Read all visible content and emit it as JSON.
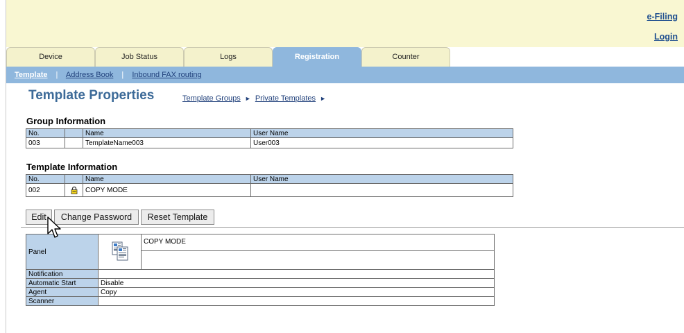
{
  "header": {
    "efiling_link": "e-Filing",
    "login_link": "Login"
  },
  "tabs": [
    {
      "label": "Device",
      "active": false
    },
    {
      "label": "Job Status",
      "active": false
    },
    {
      "label": "Logs",
      "active": false
    },
    {
      "label": "Registration",
      "active": true
    },
    {
      "label": "Counter",
      "active": false
    }
  ],
  "subnav": {
    "current": "Template",
    "separator": "|",
    "address_book": "Address Book",
    "inbound_fax": "Inbound FAX routing"
  },
  "page": {
    "title": "Template Properties",
    "breadcrumb": [
      "Template Groups",
      "Private Templates"
    ],
    "breadcrumb_arrow": "►"
  },
  "group_info": {
    "title": "Group Information",
    "headers": {
      "no": "No.",
      "name": "Name",
      "user": "User Name"
    },
    "row": {
      "no": "003",
      "name": "TemplateName003",
      "user": "User003"
    }
  },
  "template_info": {
    "title": "Template Information",
    "headers": {
      "no": "No.",
      "name": "Name",
      "user": "User Name"
    },
    "row": {
      "no": "002",
      "name": "COPY MODE",
      "user": "",
      "locked": true,
      "lock_icon": "lock-icon"
    }
  },
  "buttons": {
    "edit": "Edit",
    "change_password": "Change Password",
    "reset_template": "Reset Template"
  },
  "properties": {
    "panel_label": "Panel",
    "panel_icon": "copy-mode-icon",
    "panel_name": "COPY MODE",
    "panel_description": "",
    "notification_label": "Notification",
    "notification_value": "",
    "auto_start_label": "Automatic Start",
    "auto_start_value": "Disable",
    "agent_label": "Agent",
    "agent_value": "Copy",
    "scanner_label": "Scanner",
    "scanner_value": ""
  },
  "colors": {
    "header_bg": "#f9f7d2",
    "tab_active": "#8fb7dd",
    "title": "#3c6a98",
    "table_header": "#bcd3ea",
    "link": "#1f4f8f"
  }
}
